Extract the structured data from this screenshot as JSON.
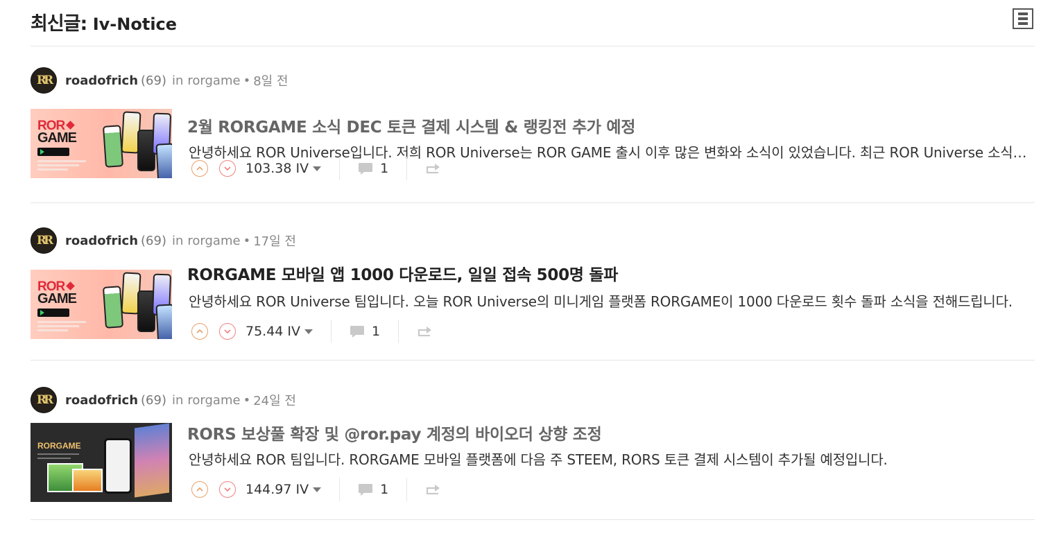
{
  "header": {
    "title": "최신글:",
    "subtitle": "Iv-Notice",
    "view_toggle_icon": "list-view-icon"
  },
  "posts": [
    {
      "author": "roadofrich",
      "reputation": "(69)",
      "in_text": "in",
      "category": "rorgame",
      "time": "8일 전",
      "title": "2월 RORGAME 소식 DEC 토큰 결제 시스템 & 랭킹전 추가 예정",
      "body": "안녕하세요 ROR Universe입니다. 저희 ROR Universe는 ROR GAME 출시 이후 많은 변화와 소식이 있었습니다. 최근 ROR Universe 소식을 전해드립니다.",
      "payout": "103.38 IV",
      "comments": "1",
      "thumb_line1": "ROR",
      "thumb_line2": "GAME",
      "title_color": "#666666"
    },
    {
      "author": "roadofrich",
      "reputation": "(69)",
      "in_text": "in",
      "category": "rorgame",
      "time": "17일 전",
      "title": "RORGAME 모바일 앱 1000 다운로드, 일일 접속 500명 돌파",
      "body": "안녕하세요 ROR Universe 팀입니다. 오늘 ROR Universe의 미니게임 플랫폼 RORGAME이 1000 다운로드 횟수 돌파 소식을 전해드립니다.",
      "payout": "75.44 IV",
      "comments": "1",
      "thumb_line1": "ROR",
      "thumb_line2": "GAME",
      "title_color": "#222222"
    },
    {
      "author": "roadofrich",
      "reputation": "(69)",
      "in_text": "in",
      "category": "rorgame",
      "time": "24일 전",
      "title": "RORS 보상풀 확장 및 @ror.pay 계정의 바이오더 상향 조정",
      "body": "안녕하세요 ROR 팀입니다. RORGAME 모바일 플랫폼에 다음 주 STEEM, RORS 토큰 결제 시스템이 추가될 예정입니다.",
      "payout": "144.97 IV",
      "comments": "1",
      "thumb_line1": "RORGAME",
      "title_color": "#666666"
    }
  ],
  "colors": {
    "upvote": "#e8a06a",
    "downvote": "#f08080",
    "divider": "#e6e6e6",
    "brand_red": "#e02a3a"
  },
  "icons": {
    "avatar_text": "RR",
    "upvote": "chevron-up-icon",
    "downvote": "chevron-down-icon",
    "comment": "comment-icon",
    "reblog": "reblog-icon",
    "dropdown": "caret-down-icon"
  }
}
